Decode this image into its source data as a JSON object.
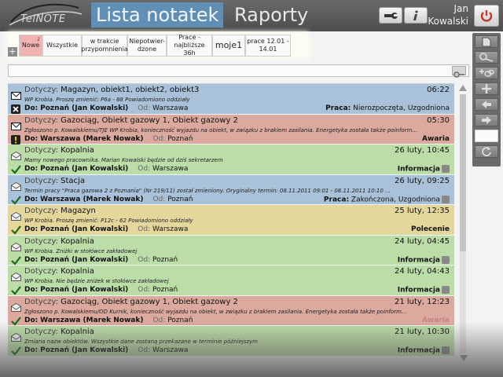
{
  "app": {
    "logo_text": "TelNOTE",
    "tabs": [
      {
        "label": "Lista notatek"
      },
      {
        "label": "Raporty"
      }
    ],
    "user": {
      "first": "Jan",
      "last": "Kowalski"
    }
  },
  "filters": [
    {
      "label": "Nowe",
      "badge": "2"
    },
    {
      "label": "Wszystkie"
    },
    {
      "label": "w trakcie przypomnienia"
    },
    {
      "label": "Niepotwier-dzone"
    },
    {
      "label": "Prace - najbliższe 36h"
    },
    {
      "label": "moje1"
    },
    {
      "label": "prace 12.01 - 14.01"
    }
  ],
  "search": {
    "value": ""
  },
  "list_labels": {
    "subject": "Dotyczy:",
    "to": "Do:",
    "from": "Od:"
  },
  "notes": [
    {
      "color": "#a9c2d9",
      "subject": "Magazyn, obiekt1, obiekt2, obiekt3",
      "time": "06:22",
      "desc": "WP Krobia.  Proszę zmienić: P6a - 88  Powiadomiono oddziały",
      "to": "Poznań (Jan Kowalski)",
      "from": "Warszawa",
      "tag_prefix": "Praca:",
      "tag": "Nierozpoczęta, Uzgodniona",
      "attach": false,
      "env": "closed",
      "status": "x"
    },
    {
      "color": "#dba99e",
      "subject": "Gazociąg, Obiekt gazowy 1, Obiekt gazowy 2",
      "time": "05:30",
      "desc": "Zgłoszono p. Kowalskiemu/TJE WP Krobia, konieczność wyjazdu na obiekt, w związku z brakiem zasilania. Energetyka została także poinform...",
      "to": "Warszawa (Marek Nowak)",
      "from": "Poznań",
      "tag_prefix": "",
      "tag": "Awaria",
      "attach": false,
      "env": "closed",
      "status": "exclaim"
    },
    {
      "color": "#bcdca8",
      "subject": "Kopalnia",
      "time": "26 luty, 10:45",
      "desc": "Mamy nowego pracownika. Marian Kowalski będzie od dziś sekretarzem",
      "to": "Poznań (Jan Kowalski)",
      "from": "Warszawa",
      "tag_prefix": "",
      "tag": "Informacja",
      "attach": true,
      "env": "open",
      "status": "check"
    },
    {
      "color": "#a9c2d9",
      "subject": "Stacja",
      "time": "26 luty, 09:25",
      "desc": "Termin pracy \"Praca gazowa 2 z Poznania\" (Nr 219/11) został zmieniony. Oryginalny termin: 08.11.2011 09:01 - 08.11.2011 10:10 ...",
      "to": "Warszawa (Marek Nowak)",
      "from": "Poznań",
      "tag_prefix": "Praca:",
      "tag": "Zakończona, Uzgodniona",
      "attach": true,
      "env": "open",
      "status": "check"
    },
    {
      "color": "#e4d79c",
      "subject": "Magazyn",
      "time": "25 luty, 12:35",
      "desc": "WP Krobia.  Proszę zmienić: P12c - 62  Powiadomiono oddziały",
      "to": "Poznań (Jan Kowalski)",
      "from": "Warszawa",
      "tag_prefix": "",
      "tag": "Polecenie",
      "attach": false,
      "env": "open",
      "status": "check"
    },
    {
      "color": "#bcdca8",
      "subject": "Kopalnia",
      "time": "24 luty, 04:45",
      "desc": "WP Krobia.  Zniżki w stołówce zakładowej",
      "to": "Poznań (Jan Kowalski)",
      "from": "Poznań",
      "tag_prefix": "",
      "tag": "Informacja",
      "attach": true,
      "env": "open",
      "status": "check"
    },
    {
      "color": "#bcdca8",
      "subject": "Kopalnia",
      "time": "24 luty, 04:43",
      "desc": "WP Krobia.  Nie będzie zniżek w stołówce zakładowej",
      "to": "Poznań (Jan Kowalski)",
      "from": "Poznań",
      "tag_prefix": "",
      "tag": "Informacja",
      "attach": true,
      "env": "open",
      "status": "check"
    },
    {
      "color": "#dba99e",
      "subject": "Gazociąg, Obiekt gazowy 1, Obiekt gazowy 2",
      "time": "21 luty, 12:23",
      "desc": "Zgłoszono p. Kowalskiemu/OD Kurnik, konieczność wyjazdu na obiekt, w związku z brakiem zasilania. Energetyka została także poinform...",
      "to": "Warszawa (Marek Nowak)",
      "from": "Poznań",
      "tag_prefix": "",
      "tag": "Awaria",
      "attach": false,
      "env": "open",
      "status": "check"
    },
    {
      "color": "#bcdca8",
      "subject": "Kopalnia",
      "time": "21 luty, 10:30",
      "desc": "Zmiana nazw obiektów. Wszystkie dane zostaną przekazane w terminie późniejszym",
      "to": "Poznań (Jan Kowalski)",
      "from": "Warszawa",
      "tag_prefix": "",
      "tag": "Informacja",
      "attach": true,
      "env": "open",
      "status": "check"
    }
  ],
  "side_toolbar": [
    {
      "icon": "document-icon"
    },
    {
      "icon": "search-key-icon"
    },
    {
      "icon": "add-link-icon"
    },
    {
      "icon": "plus-icon"
    },
    {
      "icon": "arrow-left-icon"
    },
    {
      "icon": "arrow-right-icon"
    },
    {
      "icon": "blank-icon"
    },
    {
      "icon": "refresh-icon"
    }
  ]
}
